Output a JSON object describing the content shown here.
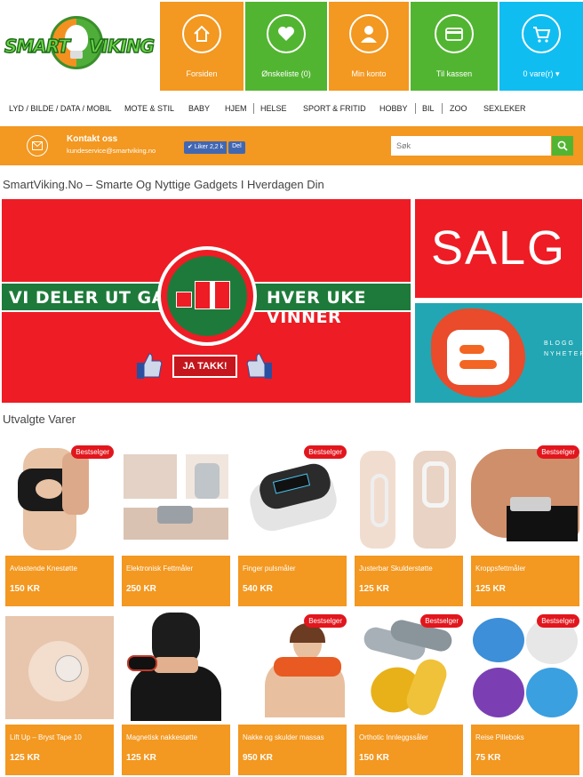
{
  "logo": {
    "word_left": "SMART",
    "word_right": "VIKING"
  },
  "nav": {
    "home": {
      "label": "Forsiden",
      "icon": "home-icon"
    },
    "wishlist": {
      "label": "Ønskeliste (0)",
      "icon": "heart-icon"
    },
    "account": {
      "label": "Min konto",
      "icon": "user-icon"
    },
    "checkout": {
      "label": "Til kassen",
      "icon": "credit-card-icon"
    },
    "cart": {
      "label": "0 vare(r)",
      "icon": "cart-icon"
    }
  },
  "categories": [
    "LYD / BILDE / DATA / MOBIL",
    "MOTE & STIL",
    "BABY",
    "HJEM",
    "HELSE",
    "SPORT & FRITID",
    "HOBBY",
    "BIL",
    "ZOO",
    "SEXLEKER"
  ],
  "contact": {
    "title": "Kontakt oss",
    "email": "kundeservice@smartviking.no"
  },
  "facebook": {
    "like": "Liker 2,2 k",
    "share": "Del"
  },
  "search": {
    "placeholder": "Søk"
  },
  "tagline": "SmartViking.No – Smarte Og Nyttige Gadgets I Hverdagen Din",
  "banners": {
    "gift_left": "VI DELER UT GAVER",
    "gift_right": "HVER UKE VINNER",
    "gift_button": "JA TAKK!",
    "sale": "SALG",
    "blog": "BLOGG NYHETER"
  },
  "section_title": "Utvalgte Varer",
  "badge_label": "Bestselger",
  "products": [
    {
      "name": "Avlastende Knestøtte",
      "price": "150 KR",
      "bestseller": true
    },
    {
      "name": "Elektronisk Fettmåler",
      "price": "250 KR",
      "bestseller": false
    },
    {
      "name": "Finger pulsmåler",
      "price": "540 KR",
      "bestseller": true
    },
    {
      "name": "Justerbar Skulderstøtte",
      "price": "125 KR",
      "bestseller": false
    },
    {
      "name": "Kroppsfettmåler",
      "price": "125 KR",
      "bestseller": true
    },
    {
      "name": "Lift Up – Bryst Tape 10",
      "price": "125 KR",
      "bestseller": false
    },
    {
      "name": "Magnetisk nakkestøtte",
      "price": "125 KR",
      "bestseller": false
    },
    {
      "name": "Nakke og skulder massas",
      "price": "950 KR",
      "bestseller": true
    },
    {
      "name": "Orthotic Innleggssåler",
      "price": "150 KR",
      "bestseller": true
    },
    {
      "name": "Reise Pilleboks",
      "price": "75 KR",
      "bestseller": true
    }
  ],
  "colors": {
    "orange": "#f39820",
    "green": "#52b531",
    "blue": "#10bdf1",
    "red": "#ee1c24"
  }
}
